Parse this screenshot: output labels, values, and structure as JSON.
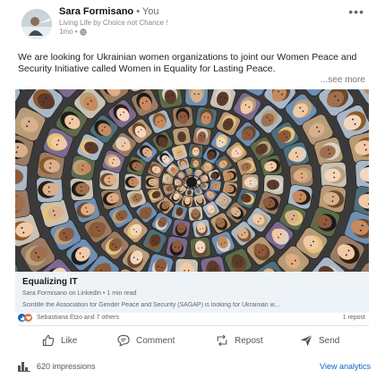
{
  "post": {
    "author": "Sara Formisano",
    "degree": "• You",
    "headline": "Living Life by Choice not Chance !",
    "time": "1mo •",
    "text": "We are looking for Ukrainian women organizations to joint our Women Peace and Security Initiative called Women in Equality for Lasting Peace.",
    "see_more": "...see more",
    "more_label": "•••"
  },
  "link_preview": {
    "title": "Equalizing IT",
    "subtitle": "Sara Formisano on LinkedIn • 1 min read",
    "description": "Scintille the Association for Gender Peace and Security (SAGAP) is looking for Ukrainian w..."
  },
  "social": {
    "reactions_text": "Sebastiana Etzo and 7 others",
    "reposts": "1 repost",
    "colors": {
      "like": "#0a66c2",
      "love": "#df704d"
    }
  },
  "actions": {
    "like": "Like",
    "comment": "Comment",
    "repost": "Repost",
    "send": "Send"
  },
  "stats": {
    "impressions": "620 impressions",
    "analytics": "View analytics",
    "accent": "#0a66c2"
  }
}
